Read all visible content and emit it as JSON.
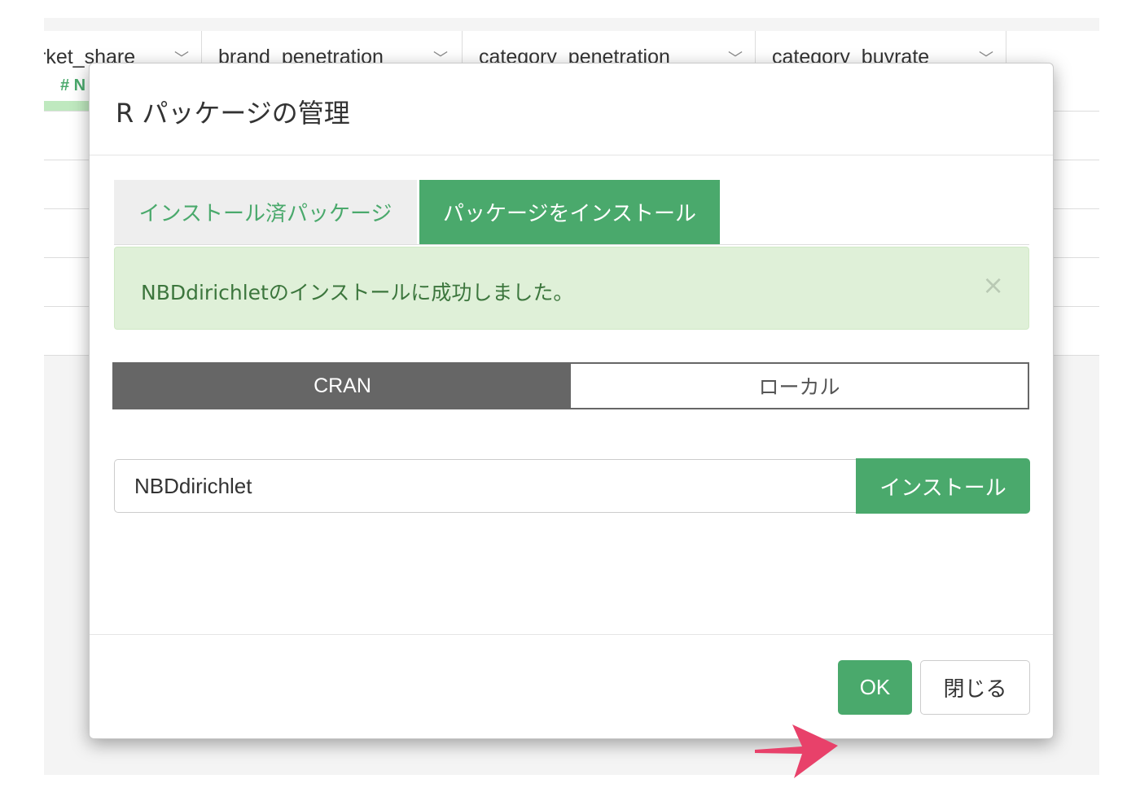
{
  "grid": {
    "columns": [
      {
        "name": "rket_share",
        "chevron": "chevron-down-icon"
      },
      {
        "name": "brand_penetration",
        "chevron": "chevron-down-icon"
      },
      {
        "name": "category_penetration",
        "chevron": "chevron-down-icon"
      },
      {
        "name": "category_buyrate",
        "chevron": "chevron-down-icon"
      }
    ],
    "first_column_type": "# N"
  },
  "modal": {
    "title": "R パッケージの管理",
    "tabs": [
      {
        "label": "インストール済パッケージ",
        "active": false
      },
      {
        "label": "パッケージをインストール",
        "active": true
      }
    ],
    "alert": {
      "message": "NBDdirichletのインストールに成功しました。",
      "close_symbol": "×"
    },
    "source_toggle": {
      "options": [
        "CRAN",
        "ローカル"
      ],
      "selected": "CRAN"
    },
    "package_input": {
      "value": "NBDdirichlet"
    },
    "install_button": "インストール",
    "footer": {
      "ok_label": "OK",
      "close_label": "閉じる"
    }
  },
  "colors": {
    "accent": "#4aa96c",
    "alert_bg": "#dff0d8",
    "alert_text": "#3c763d",
    "toggle_active": "#666666",
    "arrow": "#e8416a"
  }
}
